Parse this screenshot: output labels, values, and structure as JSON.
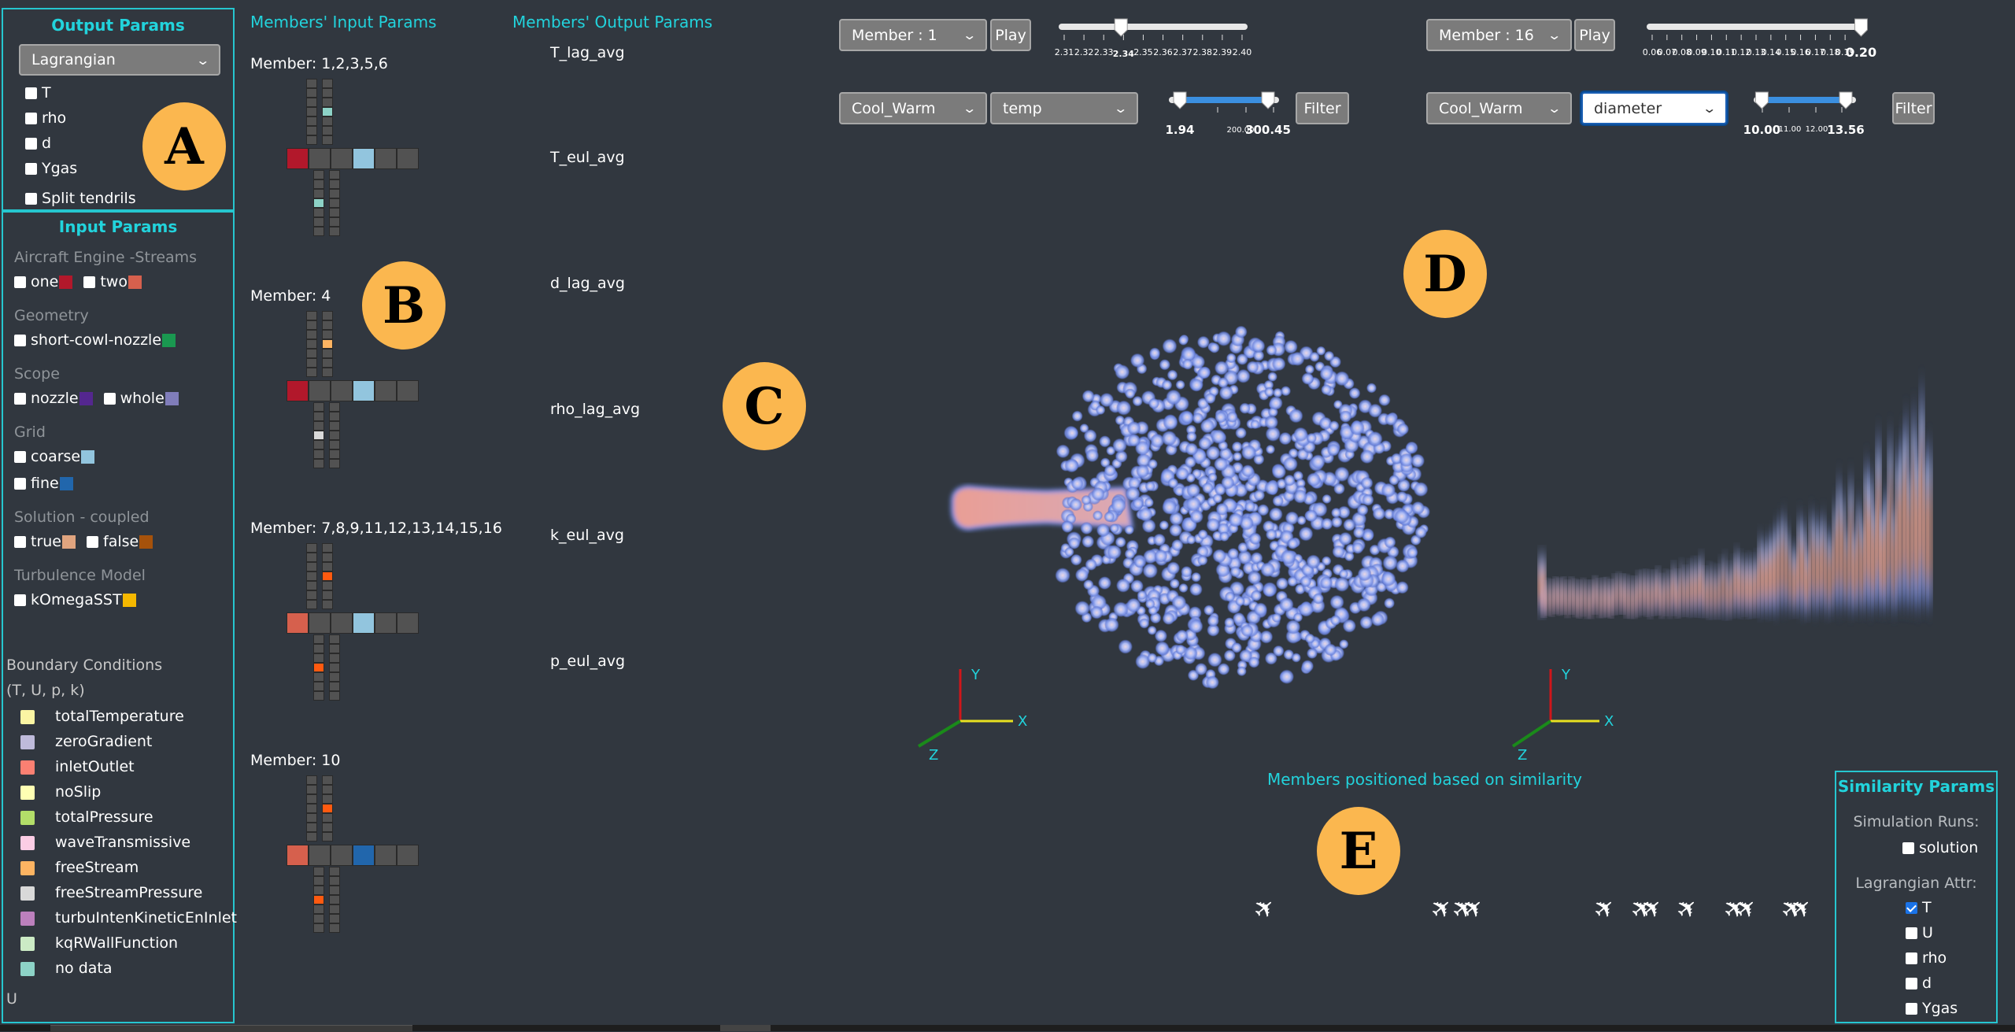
{
  "output_params": {
    "title": "Output Params",
    "select_value": "Lagrangian",
    "checkboxes": [
      {
        "label": "T",
        "checked": false
      },
      {
        "label": "rho",
        "checked": false
      },
      {
        "label": "d",
        "checked": false
      },
      {
        "label": "Ygas",
        "checked": false
      }
    ],
    "split_tendrils": {
      "label": "Split tendrils",
      "checked": false
    }
  },
  "input_params": {
    "title": "Input Params",
    "groups": [
      {
        "name": "Aircraft Engine -Streams",
        "options": [
          {
            "label": "one",
            "color": "#b2182b"
          },
          {
            "label": "two",
            "color": "#d6604d"
          }
        ]
      },
      {
        "name": "Geometry",
        "options": [
          {
            "label": "short-cowl-nozzle",
            "color": "#1a9850"
          }
        ]
      },
      {
        "name": "Scope",
        "options": [
          {
            "label": "nozzle",
            "color": "#54278f"
          },
          {
            "label": "whole",
            "color": "#807dba"
          }
        ]
      },
      {
        "name": "Grid",
        "options": [
          {
            "label": "coarse",
            "color": "#92c5de"
          }
        ],
        "options2": [
          {
            "label": "fine",
            "color": "#2166ac"
          }
        ]
      },
      {
        "name": "Solution - coupled",
        "options": [
          {
            "label": "true",
            "color": "#e0a47f"
          },
          {
            "label": "false",
            "color": "#a6520b"
          }
        ]
      },
      {
        "name": "Turbulence Model",
        "options": [
          {
            "label": "kOmegaSST",
            "color": "#f5b800"
          }
        ]
      }
    ],
    "bc_title": "Boundary Conditions",
    "bc_subtitle": "(T, U, p, k)",
    "bc_legend": [
      {
        "label": "totalTemperature",
        "color": "#fbf5a3"
      },
      {
        "label": "zeroGradient",
        "color": "#bebada"
      },
      {
        "label": "inletOutlet",
        "color": "#fb8072"
      },
      {
        "label": "noSlip",
        "color": "#ffffb3"
      },
      {
        "label": "totalPressure",
        "color": "#b3de69"
      },
      {
        "label": "waveTransmissive",
        "color": "#fccde5"
      },
      {
        "label": "freeStream",
        "color": "#fdb462"
      },
      {
        "label": "freeStreamPressure",
        "color": "#d9d9d9"
      },
      {
        "label": "turbuIntenKineticEnInlet",
        "color": "#bc80bd"
      },
      {
        "label": "kqRWallFunction",
        "color": "#ccebc5"
      },
      {
        "label": "no data",
        "color": "#8dd3c7"
      }
    ],
    "trailing_label": "U"
  },
  "members_input": {
    "title": "Members' Input Params",
    "glyphs": [
      {
        "label": "Member: 1,2,3,5,6",
        "center": [
          "#b2182b",
          "#525252",
          "#525252",
          "#92c5de",
          "#525252",
          "#525252"
        ],
        "top_right_highlight": "#8dd3c7",
        "bottom_left_highlight": "#8dd3c7"
      },
      {
        "label": "Member: 4",
        "center": [
          "#b2182b",
          "#525252",
          "#525252",
          "#92c5de",
          "#525252",
          "#525252"
        ],
        "top_right_highlight": "#fdb462",
        "bottom_left_highlight": "#d9d9d9"
      },
      {
        "label": "Member: 7,8,9,11,12,13,14,15,16",
        "center": [
          "#d6604d",
          "#525252",
          "#525252",
          "#92c5de",
          "#525252",
          "#525252"
        ],
        "top_right_highlight": "#ff5a10",
        "bottom_left_highlight": "#ff5a10"
      },
      {
        "label": "Member: 10",
        "center": [
          "#d6604d",
          "#525252",
          "#525252",
          "#2166ac",
          "#525252",
          "#525252"
        ],
        "top_right_highlight": "#ff5a10",
        "bottom_left_highlight": "#ff5a10"
      }
    ]
  },
  "members_output": {
    "title": "Members' Output Params",
    "line_color": "#f06b5e",
    "charts": [
      {
        "title": "T_lag_avg"
      },
      {
        "title": "T_eul_avg"
      },
      {
        "title": "d_lag_avg"
      },
      {
        "title": "rho_lag_avg"
      },
      {
        "title": "k_eul_avg"
      },
      {
        "title": "p_eul_avg"
      }
    ]
  },
  "view_left": {
    "member_select": "Member : 1",
    "play_label": "Play",
    "time_ticks": [
      "2.31",
      "2.32",
      "2.33",
      "2.34",
      "2.35",
      "2.36",
      "2.37",
      "2.38",
      "2.39",
      "2.40"
    ],
    "time_value": "2.34",
    "time_fraction": 0.33,
    "colormap_select": "Cool_Warm",
    "attribute_select": "temp",
    "range_min": "1.94",
    "range_mid_tick": "200.00",
    "range_max": "300.45",
    "range_fraction": [
      0.1,
      0.9
    ],
    "filter_label": "Filter",
    "axes": {
      "x": "X",
      "y": "Y",
      "z": "Z"
    }
  },
  "view_right": {
    "member_select": "Member : 16",
    "play_label": "Play",
    "time_ticks": [
      "0.06",
      "0.07",
      "0.08",
      "0.09",
      "0.10",
      "0.11",
      "0.12",
      "0.13",
      "0.14",
      "0.15",
      "0.16",
      "0.17",
      "0.18",
      "0.19"
    ],
    "time_value": "0.20",
    "time_fraction": 0.98,
    "colormap_select": "Cool_Warm",
    "attribute_select": "diameter",
    "range_min": "10.00",
    "range_ticks": [
      "11.00",
      "12.00"
    ],
    "range_max": "13.56",
    "range_fraction": [
      0.08,
      0.9
    ],
    "filter_label": "Filter",
    "axes": {
      "x": "X",
      "y": "Y",
      "z": "Z"
    }
  },
  "similarity": {
    "title": "Members positioned based on similarity",
    "plane_icon": "airplane-icon",
    "plane_count": 12
  },
  "similarity_params": {
    "title": "Similarity Params",
    "runs_label": "Simulation Runs:",
    "runs": [
      {
        "label": "solution",
        "checked": false
      }
    ],
    "attr_label": "Lagrangian Attr:",
    "attrs": [
      {
        "label": "T",
        "checked": true
      },
      {
        "label": "U",
        "checked": false
      },
      {
        "label": "rho",
        "checked": false
      },
      {
        "label": "d",
        "checked": false
      },
      {
        "label": "Ygas",
        "checked": false
      }
    ]
  },
  "badges": [
    "A",
    "B",
    "C",
    "D",
    "E"
  ]
}
